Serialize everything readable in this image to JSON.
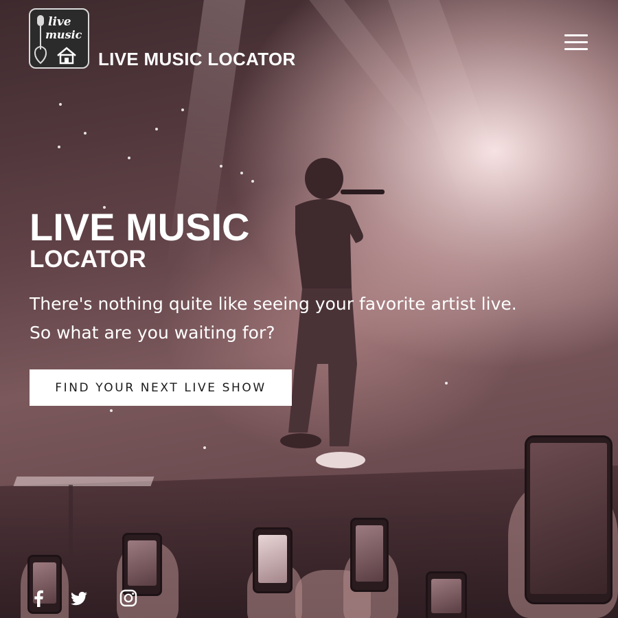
{
  "header": {
    "logo": {
      "line1": "live",
      "line2": "music"
    },
    "brand_title": "LIVE MUSIC LOCATOR",
    "menu_icon": "hamburger-menu-icon"
  },
  "hero": {
    "title_line1": "LIVE MUSIC",
    "title_line2": "LOCATOR",
    "subtitle_line1": "There's nothing quite like seeing your favorite artist live.",
    "subtitle_line2": "So what are you waiting for?",
    "cta_label": "FIND YOUR NEXT LIVE SHOW"
  },
  "social": {
    "icons": [
      "facebook-icon",
      "twitter-icon",
      "instagram-icon"
    ]
  },
  "colors": {
    "text": "#ffffff",
    "button_bg": "#ffffff",
    "button_text": "#1a1a1a",
    "overlay_tint": "#6b4b4f"
  }
}
